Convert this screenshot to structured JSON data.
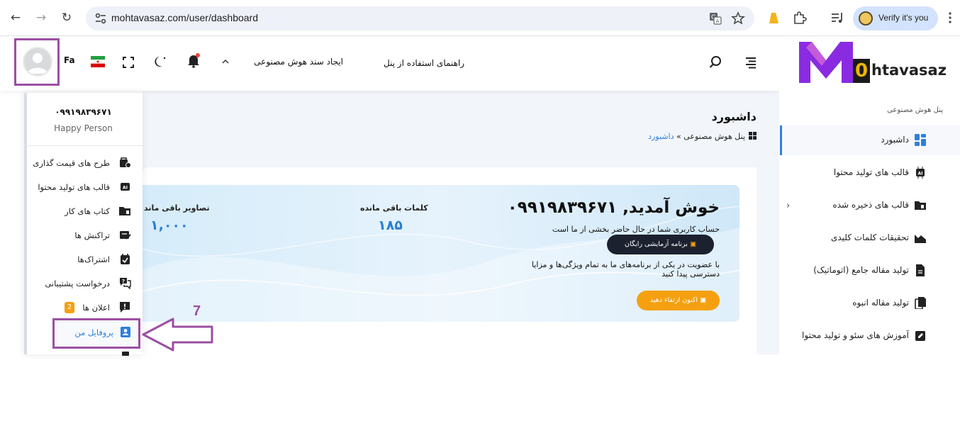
{
  "browser": {
    "url": "mohtavasaz.com/user/dashboard",
    "profile_label": "Verify it's you"
  },
  "header": {
    "lang": "Fa",
    "guide_link": "راهنمای استفاده از پنل",
    "ai_doc_menu": "ایجاد سند هوش مصنوعی"
  },
  "sidebar": {
    "logo_text": "htavasaz",
    "logo_o": "0",
    "section_title": "پنل هوش مصنوعی",
    "items": [
      {
        "label": "داشبورد",
        "icon": "dashboard-icon"
      },
      {
        "label": "قالب های تولید محتوا",
        "icon": "ai-chip-icon"
      },
      {
        "label": "قالب های ذخیره شده",
        "icon": "folder-icon"
      },
      {
        "label": "تحقیقات کلمات کلیدی",
        "icon": "chart-icon"
      },
      {
        "label": "تولید مقاله جامع (اتوماتیک)",
        "icon": "document-icon"
      },
      {
        "label": "تولید مقاله انبوه",
        "icon": "documents-icon"
      },
      {
        "label": "آموزش های سئو و تولید محتوا",
        "icon": "edit-icon"
      }
    ]
  },
  "page": {
    "title": "داشبورد",
    "breadcrumb_root": "پنل هوش مصنوعی",
    "breadcrumb_sep": "»",
    "breadcrumb_current": "داشبورد"
  },
  "welcome": {
    "title": "خوش آمدید, ۰۹۹۱۹۸۳۹۶۷۱",
    "account_line": "حساب کاربری شما در حال حاضر بخشی از ما است",
    "trial_button": "برنامه آزمایشی رایگان",
    "upgrade_line1": "با عضویت در یکی از برنامه‌های ما به تمام ویژگی‌ها و مزایا",
    "upgrade_line2": "دسترسی پیدا کنید",
    "upgrade_button": "اکنون ارتقاء دهید"
  },
  "stats": {
    "words_label": "کلمات باقی مانده",
    "words_value": "۱۸۵",
    "images_label": "تصاویر باقی ماند",
    "images_value": "۱,۰۰۰"
  },
  "user_menu": {
    "phone": "۰۹۹۱۹۸۳۹۶۷۱",
    "name": "Happy Person",
    "items": [
      {
        "label": "طرح های قیمت گذاری",
        "icon": "pricing-icon"
      },
      {
        "label": "قالب های تولید محتوا",
        "icon": "ai-chip-icon"
      },
      {
        "label": "کتاب های کار",
        "icon": "folder-icon"
      },
      {
        "label": "تراکنش ها",
        "icon": "transaction-icon"
      },
      {
        "label": "اشتراک‌ها",
        "icon": "subscription-icon"
      },
      {
        "label": "درخواست پشتیبانی",
        "icon": "support-icon"
      },
      {
        "label": "اعلان ها",
        "icon": "alert-icon",
        "badge": "2"
      }
    ],
    "profile_label": "پروفایل من"
  },
  "annotation": {
    "step": "7",
    "color": "#9b4fa3"
  },
  "colors": {
    "accent": "#2f7fe0",
    "orange": "#f5a010",
    "annotation": "#9b4fa3"
  }
}
